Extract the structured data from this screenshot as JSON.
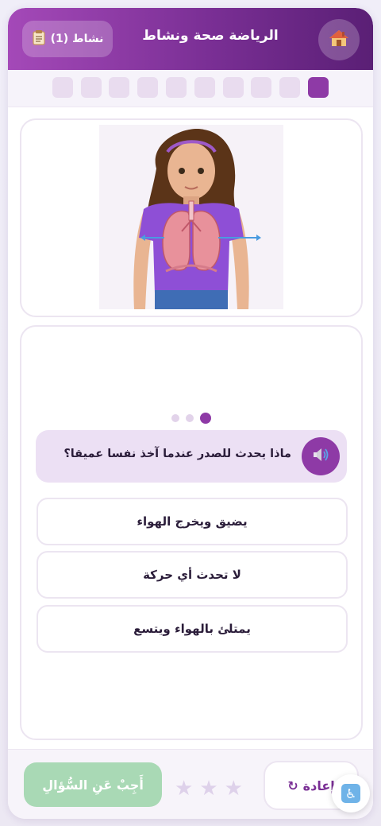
{
  "header": {
    "title": "الرياضة صحة ونشاط",
    "activity_label": "نشاط (1)",
    "home_icon": "house-icon",
    "activity_icon": "clipboard-icon"
  },
  "progress": {
    "total_steps": 10,
    "current_step": 1
  },
  "image": {
    "alt": "girl-lungs-illustration"
  },
  "quiz": {
    "pages": 3,
    "current_page": 1,
    "question": "ماذا يحدث للصدر عندما آخذ نفسا عميقا؟",
    "options": [
      "يضيق ويخرج الهواء",
      "لا تحدث أي حركة",
      "يمتلئ بالهواء ويتسع"
    ]
  },
  "footer": {
    "answer_label": "أَجِبْ عَنِ السُّؤالِ",
    "reset_label": "إعادة",
    "reset_icon": "↻",
    "stars_total": 3,
    "stars_filled": 0
  },
  "colors": {
    "accent": "#8e3aa6",
    "answer_button": "#a9d9b5",
    "star_empty": "#ded1ea"
  }
}
